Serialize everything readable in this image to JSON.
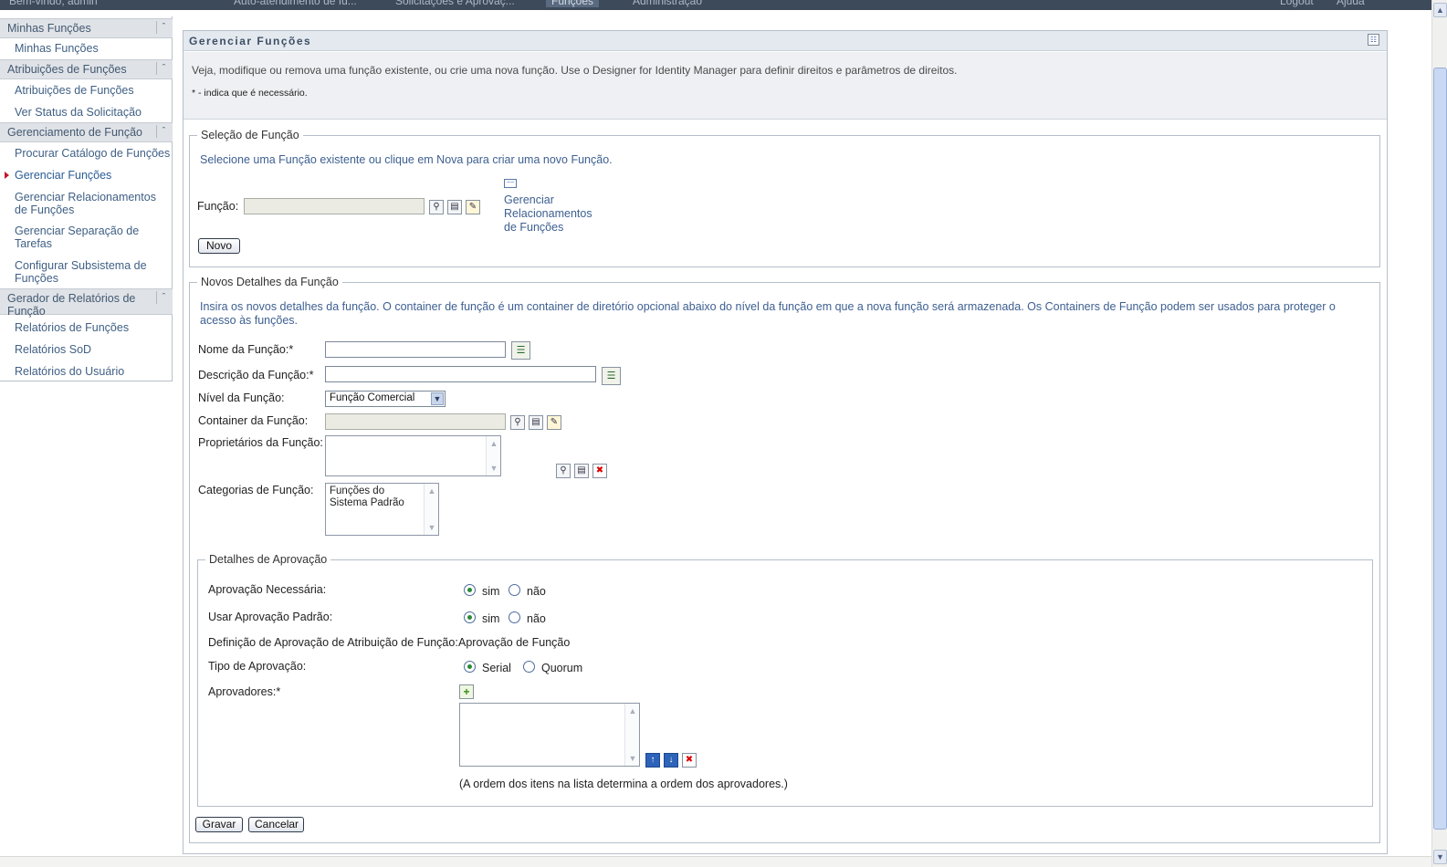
{
  "topbar": {
    "welcome": "Bem-vindo, admin",
    "tabs": [
      "Auto-atendimento de Id...",
      "Solicitações e Aprovaç...",
      "Funções",
      "Administração"
    ],
    "logout": "Logout",
    "help": "Ajuda"
  },
  "sidebar": {
    "sections": [
      {
        "title": "Minhas Funções",
        "items": [
          "Minhas Funções"
        ]
      },
      {
        "title": "Atribuições de Funções",
        "items": [
          "Atribuições de Funções",
          "Ver Status da Solicitação"
        ]
      },
      {
        "title": "Gerenciamento de Função",
        "items": [
          "Procurar Catálogo de Funções",
          "Gerenciar Funções",
          "Gerenciar Relacionamentos de Funções",
          "Gerenciar Separação de Tarefas",
          "Configurar Subsistema de Funções"
        ]
      },
      {
        "title": "Gerador de Relatórios de Função",
        "items": [
          "Relatórios de Funções",
          "Relatórios SoD",
          "Relatórios do Usuário"
        ]
      }
    ],
    "active_item": "Gerenciar Funções"
  },
  "main": {
    "title": "Gerenciar Funções",
    "description": "Veja, modifique ou remova uma função existente, ou crie uma nova função. Use o Designer for Identity Manager para definir direitos e parâmetros de direitos.",
    "required_note": "* - indica que é necessário."
  },
  "selection": {
    "legend": "Seleção de Função",
    "instruction": "Selecione uma Função existente ou clique em Nova para criar uma novo Função.",
    "role_label": "Função:",
    "role_value": "",
    "manage_link": "Gerenciar Relacionamentos de Funções",
    "new_button": "Novo"
  },
  "details": {
    "legend": "Novos Detalhes da Função",
    "instruction": "Insira os novos detalhes da função. O container de função é um container de diretório opcional abaixo do nível da função em que a nova função será armazenada. Os Containers de Função podem ser usados para proteger o acesso às funções.",
    "name_label": "Nome da Função:*",
    "name_value": "",
    "desc_label": "Descrição da Função:*",
    "desc_value": "",
    "level_label": "Nível da Função:",
    "level_value": "Função Comercial",
    "container_label": "Container da Função:",
    "container_value": "",
    "owners_label": "Proprietários da Função:",
    "categories_label": "Categorias de Função:",
    "categories": [
      "Funções do Sistema Padrão"
    ]
  },
  "approval": {
    "legend": "Detalhes de Aprovação",
    "required_label": "Aprovação Necessária:",
    "default_label": "Usar Aprovação Padrão:",
    "definition_label": "Definição de Aprovação de Atribuição de Função:",
    "definition_value": "Aprovação de Função",
    "type_label": "Tipo de Aprovação:",
    "yes": "sim",
    "no": "não",
    "serial": "Serial",
    "quorum": "Quorum",
    "approvers_label": "Aprovadores:*",
    "order_note": "(A ordem dos itens na lista determina a ordem dos aprovadores.)",
    "required_selected": "sim",
    "default_selected": "sim",
    "type_selected": "Serial"
  },
  "buttons": {
    "save": "Gravar",
    "cancel": "Cancelar"
  },
  "colors": {
    "link_blue": "#3d5f91",
    "header_bg": "#dfe3e8",
    "active_marker": "#c0182a"
  }
}
